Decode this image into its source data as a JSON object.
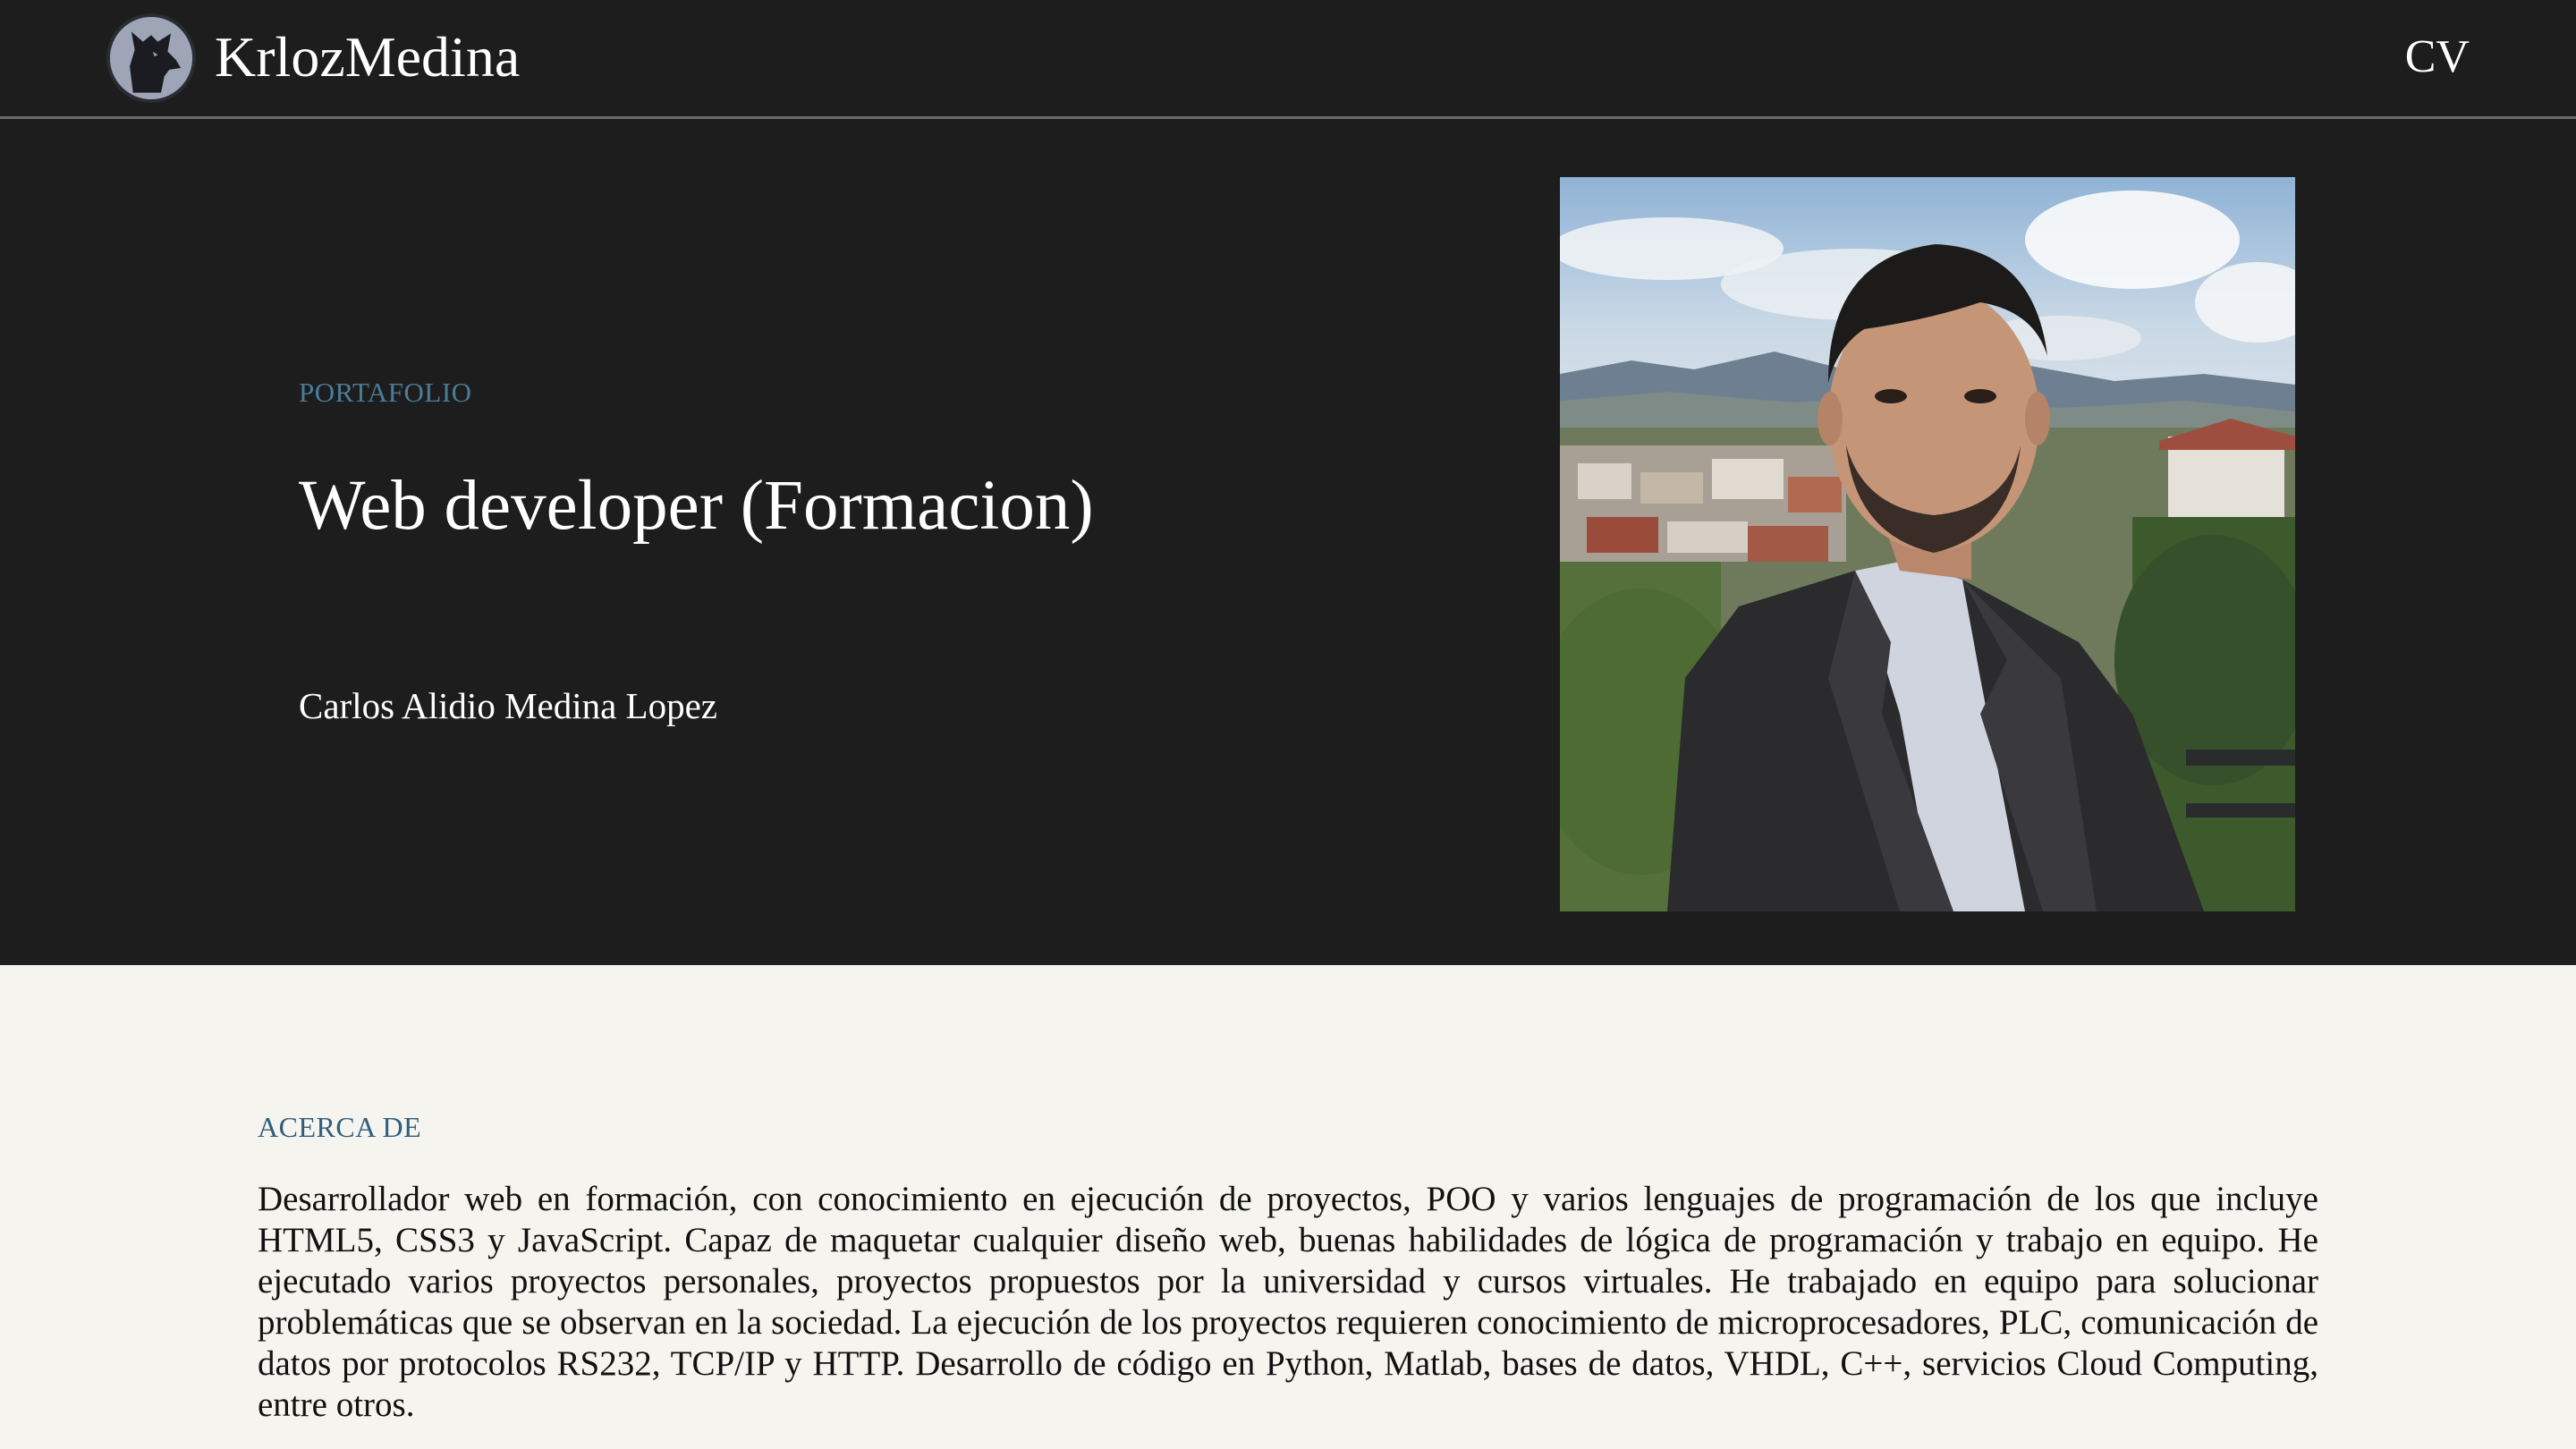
{
  "nav": {
    "brand": "KrlozMedina",
    "logo_icon": "wolf-icon",
    "cv_link": "CV",
    "background": "#1e1d1d"
  },
  "hero": {
    "eyebrow": "PORTAFOLIO",
    "title": "Web developer (Formacion)",
    "name": "Carlos Alidio Medina Lopez",
    "photo": "profile-photo",
    "accent": "#4a7c99"
  },
  "about": {
    "eyebrow": "ACERCA DE",
    "text": "Desarrollador web en formación, con conocimiento en ejecución de proyectos, POO y varios lenguajes de programación de los que incluye HTML5, CSS3 y JavaScript. Capaz de maquetar cualquier diseño web, buenas habilidades de lógica de programación y trabajo en equipo. He ejecutado varios proyectos personales, proyectos propuestos por la universidad y cursos virtuales. He trabajado en equipo para solucionar problemáticas que se observan en la sociedad. La ejecución de los proyectos requieren conocimiento de microprocesadores, PLC, comunicación de datos por protocolos RS232, TCP/IP y HTTP. Desarrollo de código en Python, Matlab, bases de datos, VHDL, C++, servicios Cloud Computing, entre otros.",
    "background": "#f5f4ef"
  }
}
